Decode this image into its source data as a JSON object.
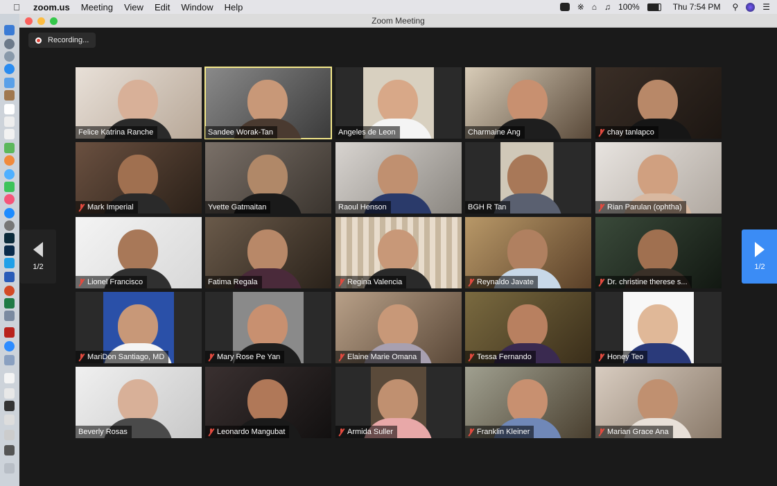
{
  "menubar": {
    "app_name": "zoom.us",
    "menus": [
      "Meeting",
      "View",
      "Edit",
      "Window",
      "Help"
    ],
    "battery": "100%",
    "clock": "Thu 7:54 PM"
  },
  "window": {
    "title": "Zoom Meeting"
  },
  "recording": {
    "label": "Recording..."
  },
  "pager": {
    "left_label": "1/2",
    "right_label": "1/2"
  },
  "accent_colors": {
    "active_speaker": "#f5e98a",
    "next_page": "#3b8cf5",
    "muted": "#e24a3f"
  },
  "participants": [
    {
      "name": "Felice Katrina Ranche",
      "muted": false,
      "active": false
    },
    {
      "name": "Sandee Worak-Tan",
      "muted": false,
      "active": true
    },
    {
      "name": "Angeles de Leon",
      "muted": false,
      "active": false
    },
    {
      "name": "Charmaine Ang",
      "muted": false,
      "active": false
    },
    {
      "name": "chay tanlapco",
      "muted": true,
      "active": false
    },
    {
      "name": "Mark Imperial",
      "muted": true,
      "active": false
    },
    {
      "name": "Yvette Gatmaitan",
      "muted": false,
      "active": false
    },
    {
      "name": "Raoul Henson",
      "muted": false,
      "active": false
    },
    {
      "name": "BGH R Tan",
      "muted": false,
      "active": false
    },
    {
      "name": "Rian Parulan (ophtha)",
      "muted": true,
      "active": false
    },
    {
      "name": "Lionel Francisco",
      "muted": true,
      "active": false
    },
    {
      "name": "Fatima Regala",
      "muted": false,
      "active": false
    },
    {
      "name": "Regina Valencia",
      "muted": true,
      "active": false
    },
    {
      "name": "Reynaldo Javate",
      "muted": true,
      "active": false
    },
    {
      "name": "Dr. christine therese s...",
      "muted": true,
      "active": false
    },
    {
      "name": "MariDon Santiago, MD",
      "muted": true,
      "active": false
    },
    {
      "name": "Mary Rose Pe Yan",
      "muted": true,
      "active": false
    },
    {
      "name": "Elaine Marie Omana",
      "muted": true,
      "active": false
    },
    {
      "name": "Tessa Fernando",
      "muted": true,
      "active": false
    },
    {
      "name": "Honey Teo",
      "muted": true,
      "active": false
    },
    {
      "name": "Beverly Rosas",
      "muted": true,
      "active": false
    },
    {
      "name": "Leonardo Mangubat",
      "muted": true,
      "active": false
    },
    {
      "name": "Armida Suller",
      "muted": true,
      "active": false
    },
    {
      "name": "Franklin Kleiner",
      "muted": true,
      "active": false
    },
    {
      "name": "Marian Grace Ana",
      "muted": true,
      "active": false
    }
  ]
}
